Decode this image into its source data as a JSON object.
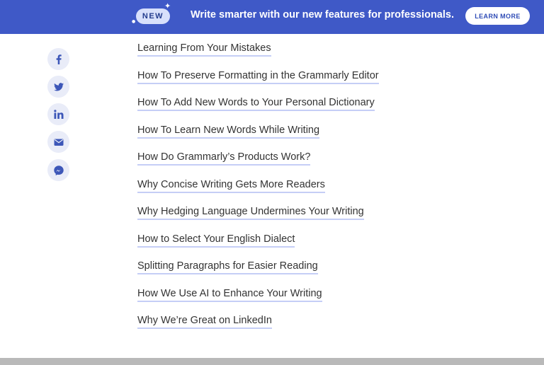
{
  "banner": {
    "badge": "NEW",
    "text": "Write smarter with our new features for professionals.",
    "button_label": "LEARN MORE"
  },
  "share": {
    "icons": [
      "facebook-icon",
      "twitter-icon",
      "linkedin-icon",
      "email-icon",
      "messenger-icon"
    ]
  },
  "links": [
    "Learning From Your Mistakes",
    "How To Preserve Formatting in the Grammarly Editor",
    "How To Add New Words to Your Personal Dictionary",
    "How To Learn New Words While Writing",
    "How Do Grammarly’s Products Work?",
    "Why Concise Writing Gets More Readers",
    "Why Hedging Language Undermines Your Writing",
    "How to Select Your English Dialect",
    "Splitting Paragraphs for Easier Reading",
    "How We Use AI to Enhance Your Writing",
    "Why We’re Great on LinkedIn"
  ],
  "colors": {
    "banner_bg": "#3f59c7",
    "badge_bg": "#d8e0fb",
    "link_underline": "#c5cef6",
    "share_bg": "#e9ecf8",
    "share_icon": "#3d57b8"
  }
}
